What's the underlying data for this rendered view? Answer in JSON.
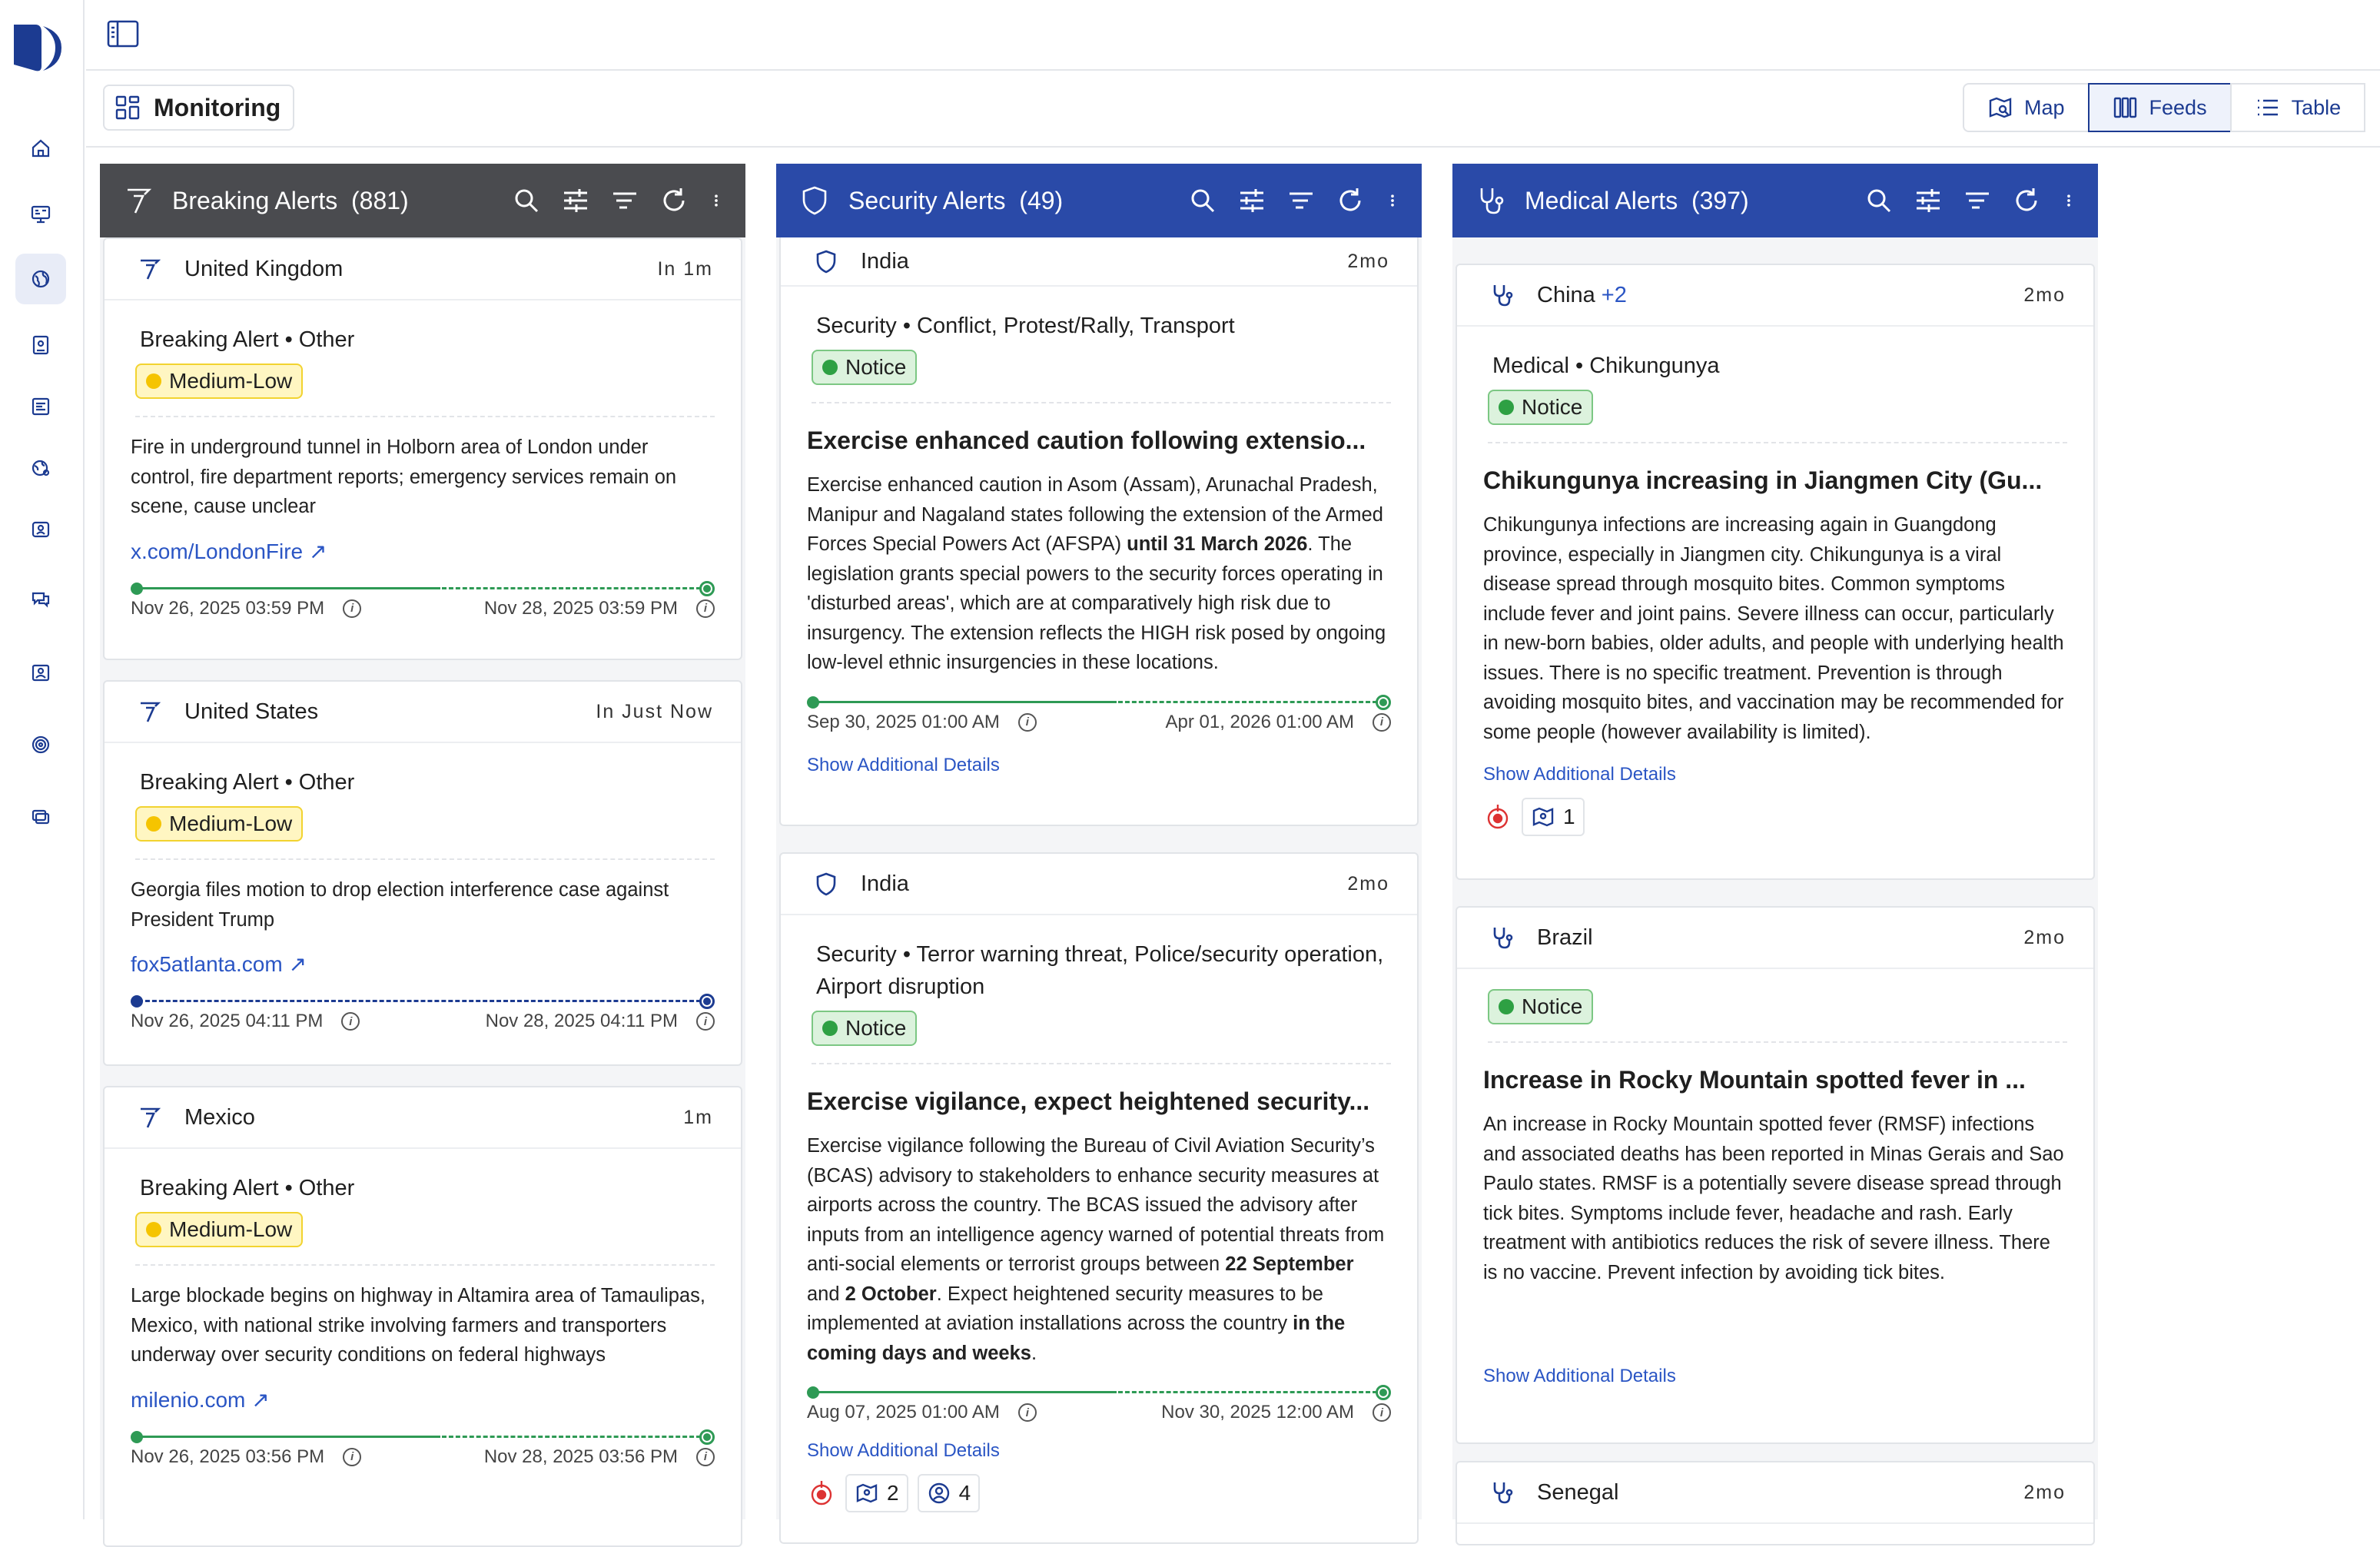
{
  "app": {
    "logo": "logo-mark"
  },
  "subheader": {
    "title": "Monitoring",
    "views": [
      {
        "label": "Map",
        "icon": "map-icon"
      },
      {
        "label": "Feeds",
        "icon": "columns-icon",
        "active": true
      },
      {
        "label": "Table",
        "icon": "list-icon"
      }
    ]
  },
  "columns": [
    {
      "title": "Breaking Alerts",
      "count": "(881)",
      "color": "#4a4b4f",
      "cards": [
        {
          "country": "United Kingdom",
          "time": "In 1m",
          "category": "Breaking Alert • Other",
          "severity": "Medium-Low",
          "description": "Fire in underground tunnel in Holborn area of London under control, fire department reports; emergency services remain on scene, cause unclear",
          "link": "x.com/LondonFire ↗",
          "start": "Nov 26, 2025 03:59 PM",
          "end": "Nov 28, 2025 03:59 PM"
        },
        {
          "country": "United States",
          "time": "In Just Now",
          "category": "Breaking Alert • Other",
          "severity": "Medium-Low",
          "description": "Georgia files motion to drop election interference case against President Trump",
          "link": "fox5atlanta.com ↗",
          "start": "Nov 26, 2025 04:11 PM",
          "end": "Nov 28, 2025 04:11 PM"
        },
        {
          "country": "Mexico",
          "time": "1m",
          "category": "Breaking Alert • Other",
          "severity": "Medium-Low",
          "description": "Large blockade begins on highway in Altamira area of Tamaulipas, Mexico, with national strike involving farmers and transporters underway over security conditions on federal highways",
          "link": "milenio.com ↗",
          "start": "Nov 26, 2025 03:56 PM",
          "end": "Nov 28, 2025 03:56 PM"
        }
      ]
    },
    {
      "title": "Security Alerts",
      "count": "(49)",
      "color": "#2a4aa8",
      "cards": [
        {
          "country": "India",
          "time": "2mo",
          "category": "Security • Conflict, Protest/Rally, Transport",
          "severity": "Notice",
          "title": "Exercise enhanced caution following extensio...",
          "description_parts": [
            "Exercise enhanced caution in Asom (Assam), Arunachal Pradesh, Manipur and Nagaland states following the extension of the Armed Forces Special Powers Act (AFSPA) ",
            "until 31 March 2026",
            ". The legislation grants special powers to the security forces operating in 'disturbed areas', which are at comparatively high risk due to insurgency. The extension reflects the HIGH risk posed by ongoing low-level ethnic insurgencies in these locations."
          ],
          "start": "Sep 30, 2025 01:00 AM",
          "end": "Apr 01, 2026 01:00 AM",
          "more": "Show Additional Details"
        },
        {
          "country": "India",
          "time": "2mo",
          "category": "Security • Terror warning threat, Police/security operation, Airport disruption",
          "severity": "Notice",
          "title": "Exercise vigilance, expect heightened security...",
          "description_parts": [
            "Exercise vigilance following the Bureau of Civil Aviation Security’s (BCAS) advisory to stakeholders to enhance security measures at airports across the country. The BCAS issued the advisory after inputs from an intelligence agency warned of potential threats from anti-social elements or terrorist groups between ",
            "22 September",
            " and ",
            "2 October",
            ". Expect heightened security measures to be implemented at aviation installations across the country ",
            "in the coming days and weeks",
            "."
          ],
          "start": "Aug 07, 2025 01:00 AM",
          "end": "Nov 30, 2025 12:00 AM",
          "more": "Show Additional Details",
          "badge1": "2",
          "badge2": "4"
        }
      ]
    },
    {
      "title": "Medical Alerts",
      "count": "(397)",
      "color": "#2a4aa8",
      "cards": [
        {
          "country": "China",
          "extra": "+2",
          "time": "2mo",
          "category": "Medical • Chikungunya",
          "severity": "Notice",
          "title": "Chikungunya increasing in Jiangmen City (Gu...",
          "description": "Chikungunya infections are increasing again in Guangdong province, especially in Jiangmen city. Chikungunya is a viral disease spread through mosquito bites. Common symptoms include fever and joint pains. Severe illness can occur, particularly in new-born babies, older adults, and people with underlying health issues. There is no specific treatment. Prevention is through avoiding mosquito bites, and vaccination may be recommended for some people (however availability is limited).",
          "more": "Show Additional Details",
          "badge1": "1"
        },
        {
          "country": "Brazil",
          "time": "2mo",
          "severity": "Notice",
          "title": "Increase in Rocky Mountain spotted fever in ...",
          "description": "An increase in Rocky Mountain spotted fever (RMSF) infections and associated deaths has been reported in Minas Gerais and Sao Paulo states. RMSF is a potentially severe disease spread through tick bites. Symptoms include fever, headache and rash. Early treatment with antibiotics reduces the risk of severe illness. There is no vaccine. Prevent infection by avoiding tick bites.",
          "more": "Show Additional Details"
        },
        {
          "country": "Senegal",
          "time": "2mo"
        }
      ]
    }
  ],
  "colors": {
    "brand": "#1c3b91",
    "link": "#2a55c4",
    "green": "#2ea043"
  }
}
